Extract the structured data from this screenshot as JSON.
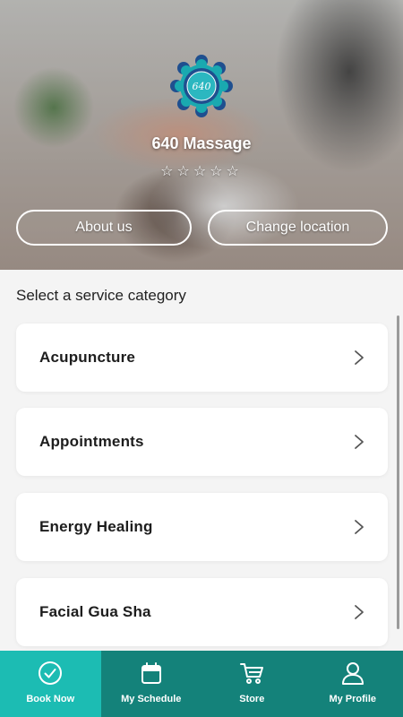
{
  "hero": {
    "logo_text": "640",
    "business_name": "640 Massage",
    "rating": 0,
    "stars": "☆☆☆☆☆",
    "about_label": "About us",
    "change_location_label": "Change location"
  },
  "main": {
    "section_title": "Select a service category",
    "categories": [
      {
        "label": "Acupuncture"
      },
      {
        "label": "Appointments"
      },
      {
        "label": "Energy Healing"
      },
      {
        "label": "Facial Gua Sha"
      }
    ]
  },
  "nav": {
    "items": [
      {
        "label": "Book Now",
        "icon": "check-circle-icon",
        "active": true
      },
      {
        "label": "My Schedule",
        "icon": "calendar-icon",
        "active": false
      },
      {
        "label": "Store",
        "icon": "cart-icon",
        "active": false
      },
      {
        "label": "My Profile",
        "icon": "user-icon",
        "active": false
      }
    ]
  },
  "colors": {
    "nav_bg": "#14827a",
    "nav_active": "#1cbcb3",
    "logo_teal": "#1aa9b0",
    "logo_blue": "#1f4f8f"
  }
}
